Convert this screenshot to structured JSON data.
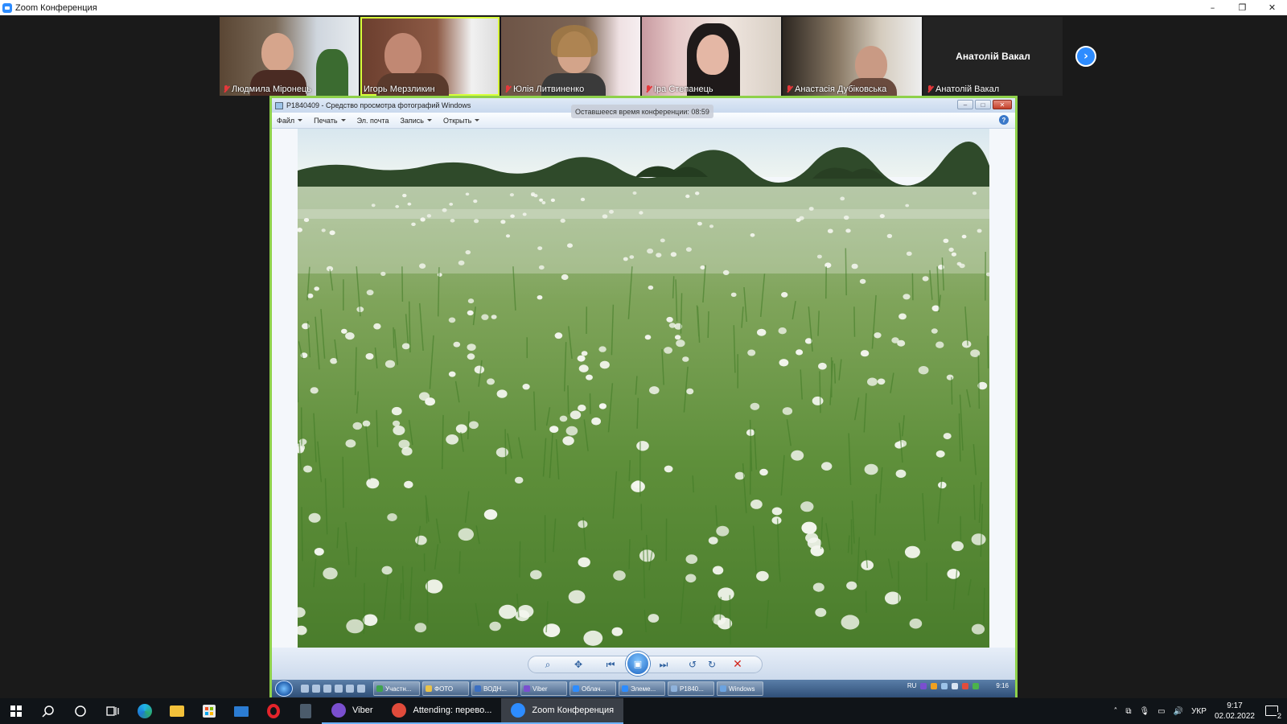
{
  "zoom_window": {
    "title": "Zoom Конференция",
    "controls": [
      "–",
      "❐",
      "✕"
    ]
  },
  "participants": [
    {
      "name": "Людмила Міронець",
      "muted": true,
      "active": false
    },
    {
      "name": "Игорь Мерзликин",
      "muted": false,
      "active": true
    },
    {
      "name": "Юлія Литвиненко",
      "muted": true,
      "active": false
    },
    {
      "name": "Іра Степанець",
      "muted": true,
      "active": false
    },
    {
      "name": "Анастасія Дубіковська",
      "muted": true,
      "active": false
    },
    {
      "name": "Анатолій Вакал",
      "muted": true,
      "active": false,
      "video_off": true
    }
  ],
  "next_page_icon": "chevron-right-icon",
  "photo_viewer": {
    "title": "P1840409 - Средство просмотра фотографий Windows",
    "remaining_time": "Оставшееся время конференции: 08:59",
    "menu": [
      {
        "label": "Файл",
        "dropdown": true
      },
      {
        "label": "Печать",
        "dropdown": true
      },
      {
        "label": "Эл. почта",
        "dropdown": false
      },
      {
        "label": "Запись",
        "dropdown": true
      },
      {
        "label": "Открыть",
        "dropdown": true
      }
    ],
    "controls": [
      "zoom-icon",
      "fit-icon",
      "previous-icon",
      "slideshow-icon",
      "next-icon",
      "rotate-left-icon",
      "rotate-right-icon",
      "delete-icon"
    ]
  },
  "win7_taskbar": {
    "tasks": [
      {
        "label": "Участн...",
        "color": "#3fa34d"
      },
      {
        "label": "ФОТО",
        "color": "#e8c24a"
      },
      {
        "label": "ВОДН...",
        "color": "#3b6fc2"
      },
      {
        "label": "Viber",
        "color": "#7a4fcf"
      },
      {
        "label": "Облач...",
        "color": "#2d8cff"
      },
      {
        "label": "Элеме...",
        "color": "#2d8cff"
      },
      {
        "label": "P1840...",
        "color": "#8fb3dc"
      },
      {
        "label": "Windows",
        "color": "#6ba3e0"
      }
    ],
    "lang": "RU",
    "time": "9:16"
  },
  "taskbar": {
    "apps": [
      {
        "label": "Viber",
        "color": "#7a4fcf",
        "active": false
      },
      {
        "label": "Attending: перево...",
        "color": "#e04b3b",
        "active": false
      },
      {
        "label": "Zoom Конференция",
        "color": "#2d8cff",
        "active": true
      }
    ],
    "lang": "УКР",
    "time": "9:17",
    "date": "02.02.2022",
    "notifications": "2"
  }
}
